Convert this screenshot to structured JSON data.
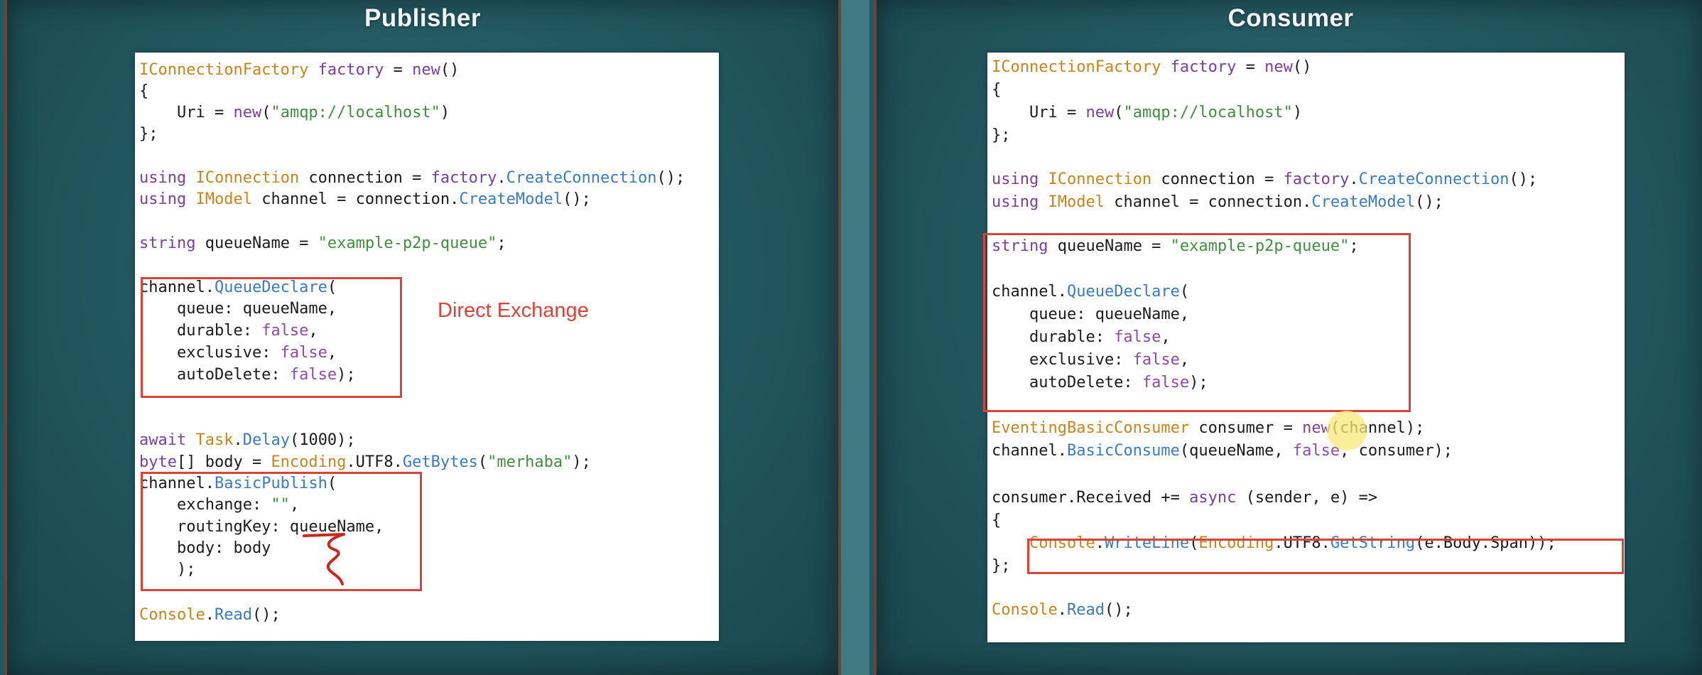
{
  "publisher": {
    "title": "Publisher",
    "note": "Direct Exchange",
    "code": [
      [
        {
          "c": "t",
          "v": "IConnectionFactory"
        },
        {
          "c": "",
          "v": " "
        },
        {
          "c": "k",
          "v": "factory"
        },
        {
          "c": "",
          "v": " = "
        },
        {
          "c": "k",
          "v": "new"
        },
        {
          "c": "",
          "v": "()"
        }
      ],
      [
        {
          "c": "",
          "v": "{"
        }
      ],
      [
        {
          "c": "",
          "v": "    Uri = "
        },
        {
          "c": "k",
          "v": "new"
        },
        {
          "c": "",
          "v": "("
        },
        {
          "c": "s",
          "v": "\"amqp://localhost\""
        },
        {
          "c": "",
          "v": ")"
        }
      ],
      [
        {
          "c": "",
          "v": "};"
        }
      ],
      [
        {
          "c": "k",
          "v": "using"
        },
        {
          "c": "",
          "v": " "
        },
        {
          "c": "t",
          "v": "IConnection"
        },
        {
          "c": "",
          "v": " connection = "
        },
        {
          "c": "k",
          "v": "factory"
        },
        {
          "c": "",
          "v": "."
        },
        {
          "c": "m",
          "v": "CreateConnection"
        },
        {
          "c": "",
          "v": "();"
        }
      ],
      [
        {
          "c": "k",
          "v": "using"
        },
        {
          "c": "",
          "v": " "
        },
        {
          "c": "t",
          "v": "IModel"
        },
        {
          "c": "",
          "v": " channel = connection."
        },
        {
          "c": "m",
          "v": "CreateModel"
        },
        {
          "c": "",
          "v": "();"
        }
      ],
      [
        {
          "c": "k",
          "v": "string"
        },
        {
          "c": "",
          "v": " queueName = "
        },
        {
          "c": "s",
          "v": "\"example-p2p-queue\""
        },
        {
          "c": "",
          "v": ";"
        }
      ],
      [
        {
          "c": "",
          "v": "channel."
        },
        {
          "c": "m",
          "v": "QueueDeclare"
        },
        {
          "c": "",
          "v": "("
        }
      ],
      [
        {
          "c": "",
          "v": "    queue: queueName,"
        }
      ],
      [
        {
          "c": "",
          "v": "    durable: "
        },
        {
          "c": "f",
          "v": "false"
        },
        {
          "c": "",
          "v": ","
        }
      ],
      [
        {
          "c": "",
          "v": "    exclusive: "
        },
        {
          "c": "f",
          "v": "false"
        },
        {
          "c": "",
          "v": ","
        }
      ],
      [
        {
          "c": "",
          "v": "    autoDelete: "
        },
        {
          "c": "f",
          "v": "false"
        },
        {
          "c": "",
          "v": ");"
        }
      ],
      [
        {
          "c": "k",
          "v": "await"
        },
        {
          "c": "",
          "v": " "
        },
        {
          "c": "t",
          "v": "Task"
        },
        {
          "c": "",
          "v": "."
        },
        {
          "c": "m",
          "v": "Delay"
        },
        {
          "c": "",
          "v": "(1000);"
        }
      ],
      [
        {
          "c": "k",
          "v": "byte"
        },
        {
          "c": "",
          "v": "[] body = "
        },
        {
          "c": "t",
          "v": "Encoding"
        },
        {
          "c": "",
          "v": ".UTF8."
        },
        {
          "c": "m",
          "v": "GetBytes"
        },
        {
          "c": "",
          "v": "("
        },
        {
          "c": "s",
          "v": "\"merhaba\""
        },
        {
          "c": "",
          "v": ");"
        }
      ],
      [
        {
          "c": "",
          "v": "channel."
        },
        {
          "c": "m",
          "v": "BasicPublish"
        },
        {
          "c": "",
          "v": "("
        }
      ],
      [
        {
          "c": "",
          "v": "    exchange: "
        },
        {
          "c": "s",
          "v": "\"\""
        },
        {
          "c": "",
          "v": ","
        }
      ],
      [
        {
          "c": "",
          "v": "    routingKey: queueName,"
        }
      ],
      [
        {
          "c": "",
          "v": "    body: body"
        }
      ],
      [
        {
          "c": "",
          "v": "    );"
        }
      ],
      [
        {
          "c": "t",
          "v": "Console"
        },
        {
          "c": "",
          "v": "."
        },
        {
          "c": "m",
          "v": "Read"
        },
        {
          "c": "",
          "v": "();"
        }
      ]
    ]
  },
  "consumer": {
    "title": "Consumer",
    "code": [
      [
        {
          "c": "t",
          "v": "IConnectionFactory"
        },
        {
          "c": "",
          "v": " "
        },
        {
          "c": "k",
          "v": "factory"
        },
        {
          "c": "",
          "v": " = "
        },
        {
          "c": "k",
          "v": "new"
        },
        {
          "c": "",
          "v": "()"
        }
      ],
      [
        {
          "c": "",
          "v": "{"
        }
      ],
      [
        {
          "c": "",
          "v": "    Uri = "
        },
        {
          "c": "k",
          "v": "new"
        },
        {
          "c": "",
          "v": "("
        },
        {
          "c": "s",
          "v": "\"amqp://localhost\""
        },
        {
          "c": "",
          "v": ")"
        }
      ],
      [
        {
          "c": "",
          "v": "};"
        }
      ],
      [
        {
          "c": "k",
          "v": "using"
        },
        {
          "c": "",
          "v": " "
        },
        {
          "c": "t",
          "v": "IConnection"
        },
        {
          "c": "",
          "v": " connection = "
        },
        {
          "c": "k",
          "v": "factory"
        },
        {
          "c": "",
          "v": "."
        },
        {
          "c": "m",
          "v": "CreateConnection"
        },
        {
          "c": "",
          "v": "();"
        }
      ],
      [
        {
          "c": "k",
          "v": "using"
        },
        {
          "c": "",
          "v": " "
        },
        {
          "c": "t",
          "v": "IModel"
        },
        {
          "c": "",
          "v": " channel = connection."
        },
        {
          "c": "m",
          "v": "CreateModel"
        },
        {
          "c": "",
          "v": "();"
        }
      ],
      [
        {
          "c": "k",
          "v": "string"
        },
        {
          "c": "",
          "v": " queueName = "
        },
        {
          "c": "s",
          "v": "\"example-p2p-queue\""
        },
        {
          "c": "",
          "v": ";"
        }
      ],
      [
        {
          "c": "",
          "v": "channel."
        },
        {
          "c": "m",
          "v": "QueueDeclare"
        },
        {
          "c": "",
          "v": "("
        }
      ],
      [
        {
          "c": "",
          "v": "    queue: queueName,"
        }
      ],
      [
        {
          "c": "",
          "v": "    durable: "
        },
        {
          "c": "f",
          "v": "false"
        },
        {
          "c": "",
          "v": ","
        }
      ],
      [
        {
          "c": "",
          "v": "    exclusive: "
        },
        {
          "c": "f",
          "v": "false"
        },
        {
          "c": "",
          "v": ","
        }
      ],
      [
        {
          "c": "",
          "v": "    autoDelete: "
        },
        {
          "c": "f",
          "v": "false"
        },
        {
          "c": "",
          "v": ");"
        }
      ],
      [
        {
          "c": "t",
          "v": "EventingBasicConsumer"
        },
        {
          "c": "",
          "v": " consumer = "
        },
        {
          "c": "k",
          "v": "new"
        },
        {
          "c": "",
          "v": "(channel);"
        }
      ],
      [
        {
          "c": "",
          "v": "channel."
        },
        {
          "c": "m",
          "v": "BasicConsume"
        },
        {
          "c": "",
          "v": "(queueName, "
        },
        {
          "c": "f",
          "v": "false"
        },
        {
          "c": "",
          "v": ", consumer);"
        }
      ],
      [
        {
          "c": "",
          "v": "consumer.Received += "
        },
        {
          "c": "k",
          "v": "async"
        },
        {
          "c": "",
          "v": " (sender, e) =>"
        }
      ],
      [
        {
          "c": "",
          "v": "{"
        }
      ],
      [
        {
          "c": "",
          "v": "    "
        },
        {
          "c": "t",
          "v": "Console"
        },
        {
          "c": "",
          "v": "."
        },
        {
          "c": "m",
          "v": "WriteLine"
        },
        {
          "c": "",
          "v": "("
        },
        {
          "c": "t",
          "v": "Encoding"
        },
        {
          "c": "",
          "v": ".UTF8."
        },
        {
          "c": "m",
          "v": "GetString"
        },
        {
          "c": "",
          "v": "(e.Body.Span));"
        }
      ],
      [
        {
          "c": "",
          "v": "};"
        }
      ],
      [
        {
          "c": "t",
          "v": "Console"
        },
        {
          "c": "",
          "v": "."
        },
        {
          "c": "m",
          "v": "Read"
        },
        {
          "c": "",
          "v": "();"
        }
      ]
    ]
  }
}
